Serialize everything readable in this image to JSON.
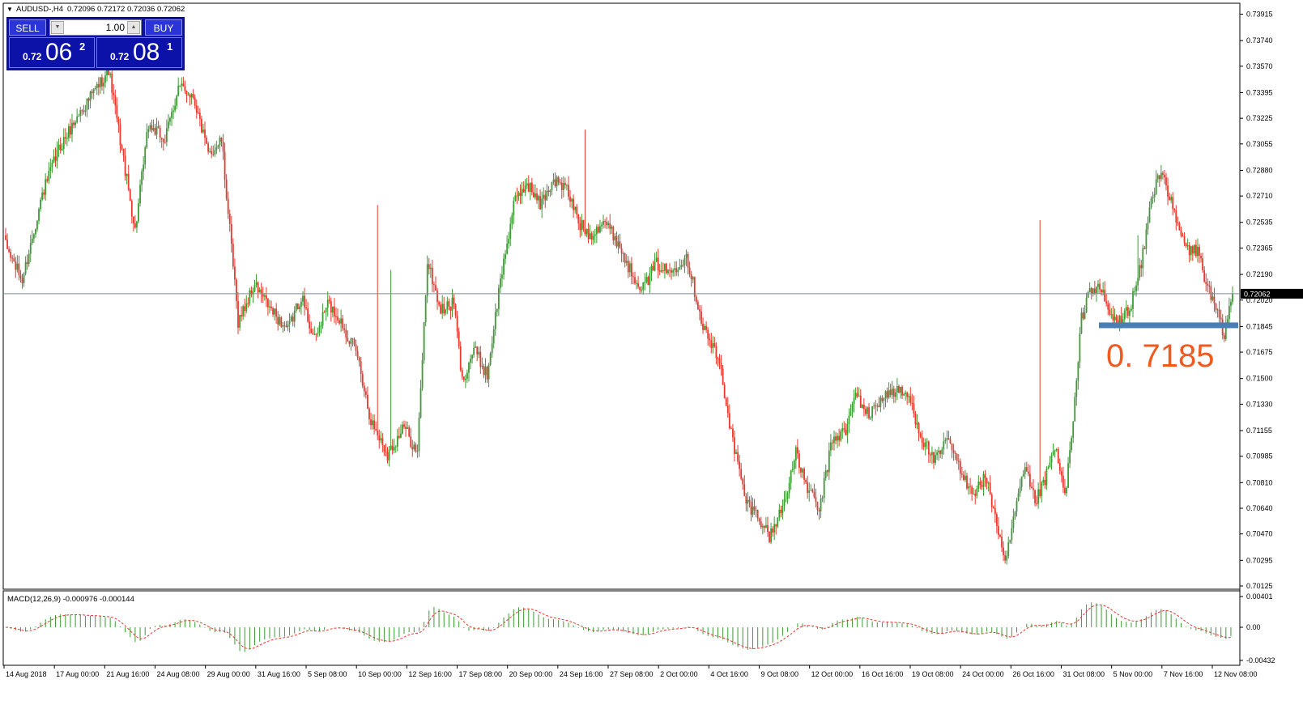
{
  "header": {
    "symbol": "AUDUSD-,H4",
    "ohlc": "0.72096 0.72172 0.72036 0.72062"
  },
  "trade_panel": {
    "sell_label": "SELL",
    "buy_label": "BUY",
    "lot_value": "1.00",
    "bid": {
      "prefix": "0.72",
      "big": "06",
      "sup": "2"
    },
    "ask": {
      "prefix": "0.72",
      "big": "08",
      "sup": "1"
    }
  },
  "price_axis": {
    "ticks": [
      "0.73915",
      "0.73740",
      "0.73570",
      "0.73395",
      "0.73225",
      "0.73055",
      "0.72880",
      "0.72710",
      "0.72535",
      "0.72365",
      "0.72190",
      "0.72020",
      "0.71845",
      "0.71675",
      "0.71500",
      "0.71330",
      "0.71155",
      "0.70985",
      "0.70810",
      "0.70640",
      "0.70470",
      "0.70295",
      "0.70125"
    ],
    "current_label": "0.72062"
  },
  "annotation": {
    "level_text": "0. 7185",
    "level_value": 0.7185,
    "level_color": "#4a7fb5",
    "text_color": "#f05a1e"
  },
  "macd": {
    "label": "MACD(12,26,9) -0.000976 -0.000144",
    "ticks": [
      "0.00401",
      "0.00",
      "-0.00432"
    ]
  },
  "time_axis": {
    "labels": [
      "14 Aug 2018",
      "17 Aug 00:00",
      "21 Aug 16:00",
      "24 Aug 08:00",
      "29 Aug 00:00",
      "31 Aug 16:00",
      "5 Sep 08:00",
      "10 Sep 00:00",
      "12 Sep 16:00",
      "17 Sep 08:00",
      "20 Sep 00:00",
      "24 Sep 16:00",
      "27 Sep 08:00",
      "2 Oct 00:00",
      "4 Oct 16:00",
      "9 Oct 08:00",
      "12 Oct 00:00",
      "16 Oct 16:00",
      "19 Oct 08:00",
      "24 Oct 00:00",
      "26 Oct 16:00",
      "31 Oct 08:00",
      "5 Nov 00:00",
      "7 Nov 16:00",
      "12 Nov 08:00"
    ]
  },
  "colors": {
    "bull": "#3d9b35",
    "bear": "#e8392e",
    "signal": "#e8392e",
    "histogram": "#3d9b35",
    "grid_line": "#7a8a92"
  },
  "chart_data": {
    "type": "candlestick",
    "symbol": "AUDUSD",
    "timeframe": "H4",
    "ylim": [
      0.70125,
      0.73915
    ],
    "path_points": [
      [
        0,
        0.7238
      ],
      [
        10,
        0.7215
      ],
      [
        22,
        0.7272
      ],
      [
        32,
        0.7302
      ],
      [
        44,
        0.7325
      ],
      [
        55,
        0.7343
      ],
      [
        62,
        0.7355
      ],
      [
        72,
        0.7288
      ],
      [
        78,
        0.7248
      ],
      [
        86,
        0.7318
      ],
      [
        96,
        0.7308
      ],
      [
        104,
        0.7343
      ],
      [
        113,
        0.7338
      ],
      [
        122,
        0.7298
      ],
      [
        130,
        0.7308
      ],
      [
        140,
        0.7188
      ],
      [
        150,
        0.7212
      ],
      [
        160,
        0.7195
      ],
      [
        170,
        0.7182
      ],
      [
        178,
        0.7205
      ],
      [
        186,
        0.7175
      ],
      [
        194,
        0.72
      ],
      [
        202,
        0.7188
      ],
      [
        212,
        0.7165
      ],
      [
        220,
        0.7122
      ],
      [
        230,
        0.71
      ],
      [
        240,
        0.7118
      ],
      [
        248,
        0.71
      ],
      [
        254,
        0.7228
      ],
      [
        262,
        0.7195
      ],
      [
        270,
        0.72
      ],
      [
        275,
        0.7148
      ],
      [
        282,
        0.717
      ],
      [
        290,
        0.7152
      ],
      [
        298,
        0.7215
      ],
      [
        306,
        0.7265
      ],
      [
        314,
        0.728
      ],
      [
        322,
        0.7265
      ],
      [
        330,
        0.7282
      ],
      [
        338,
        0.7275
      ],
      [
        346,
        0.7252
      ],
      [
        352,
        0.7245
      ],
      [
        360,
        0.7255
      ],
      [
        368,
        0.7242
      ],
      [
        376,
        0.7222
      ],
      [
        384,
        0.721
      ],
      [
        392,
        0.7226
      ],
      [
        400,
        0.722
      ],
      [
        410,
        0.7232
      ],
      [
        420,
        0.7185
      ],
      [
        430,
        0.716
      ],
      [
        438,
        0.7108
      ],
      [
        446,
        0.7068
      ],
      [
        454,
        0.7058
      ],
      [
        460,
        0.7045
      ],
      [
        468,
        0.7065
      ],
      [
        476,
        0.71
      ],
      [
        482,
        0.708
      ],
      [
        490,
        0.7062
      ],
      [
        498,
        0.711
      ],
      [
        506,
        0.7115
      ],
      [
        512,
        0.714
      ],
      [
        520,
        0.7125
      ],
      [
        528,
        0.7138
      ],
      [
        536,
        0.7142
      ],
      [
        544,
        0.7138
      ],
      [
        552,
        0.711
      ],
      [
        560,
        0.7095
      ],
      [
        568,
        0.711
      ],
      [
        576,
        0.7085
      ],
      [
        584,
        0.7075
      ],
      [
        590,
        0.7085
      ],
      [
        596,
        0.706
      ],
      [
        602,
        0.7025
      ],
      [
        608,
        0.7062
      ],
      [
        614,
        0.709
      ],
      [
        620,
        0.7068
      ],
      [
        626,
        0.7082
      ],
      [
        632,
        0.7105
      ],
      [
        638,
        0.7072
      ],
      [
        643,
        0.712
      ],
      [
        648,
        0.719
      ],
      [
        653,
        0.721
      ],
      [
        660,
        0.7208
      ],
      [
        666,
        0.719
      ],
      [
        672,
        0.7188
      ],
      [
        678,
        0.72
      ],
      [
        684,
        0.7225
      ],
      [
        690,
        0.7268
      ],
      [
        696,
        0.729
      ],
      [
        701,
        0.727
      ],
      [
        706,
        0.725
      ],
      [
        712,
        0.7235
      ],
      [
        718,
        0.7235
      ],
      [
        724,
        0.721
      ],
      [
        729,
        0.7195
      ],
      [
        734,
        0.7178
      ],
      [
        739,
        0.7208
      ]
    ],
    "intraday_high_samples": [
      [
        224,
        0.7265
      ],
      [
        232,
        0.7222
      ],
      [
        349,
        0.7315
      ],
      [
        623,
        0.7255
      ],
      [
        682,
        0.7245
      ]
    ],
    "annotation_level": 0.7185,
    "macd": {
      "fast": 12,
      "slow": 26,
      "signal": 9,
      "last_main": -0.000976,
      "last_signal": -0.000144,
      "ylim": [
        -0.00432,
        0.00401
      ]
    }
  }
}
